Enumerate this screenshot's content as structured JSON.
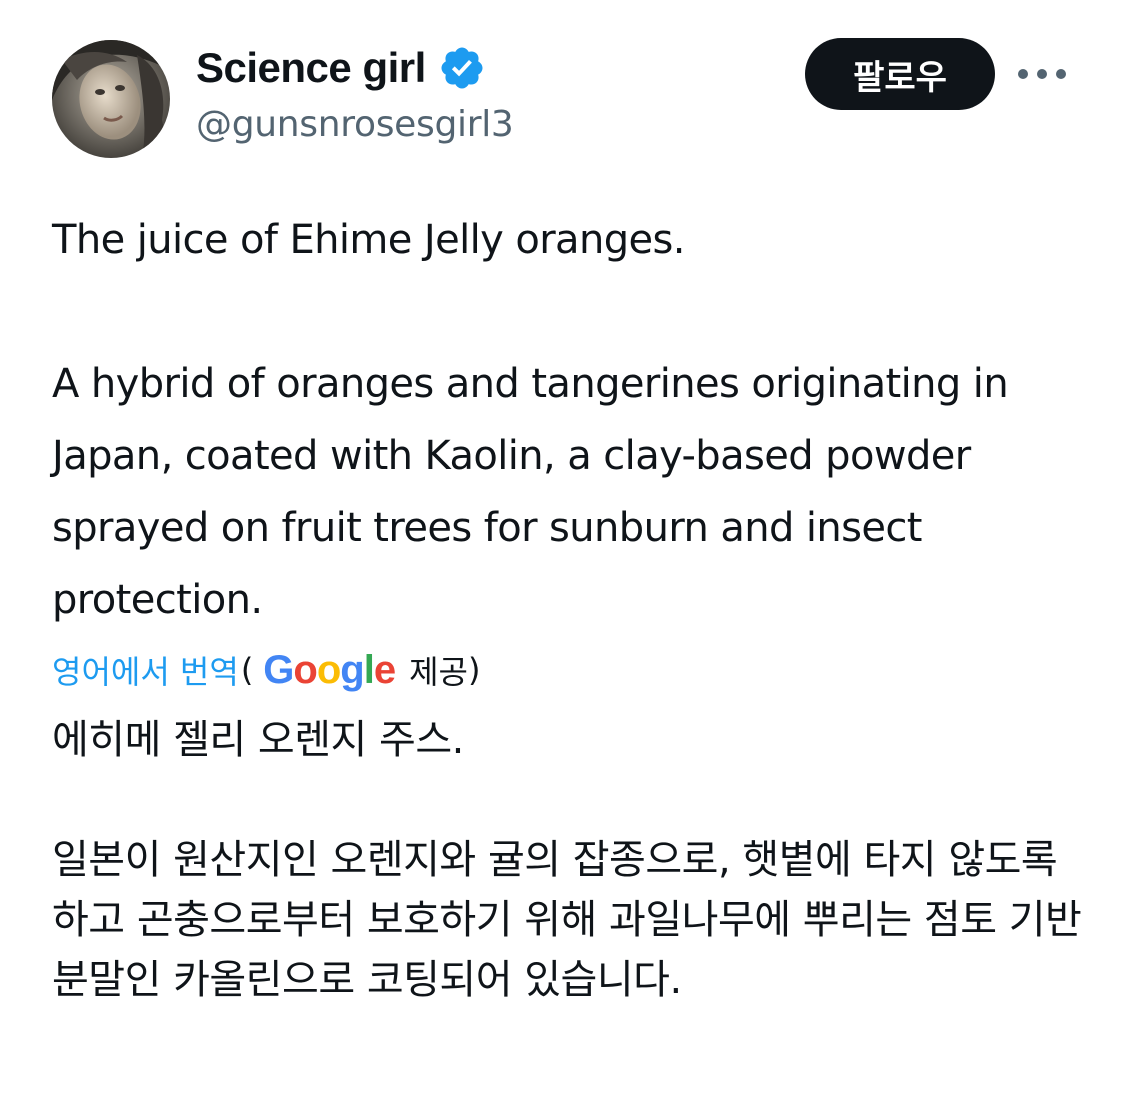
{
  "tweet": {
    "author": {
      "display_name": "Science girl",
      "handle": "@gunsnrosesgirl3",
      "verified": true,
      "avatar_icon": "profile-photo"
    },
    "follow_button_label": "팔로우",
    "more_icon": "more-dots-icon",
    "text": "The juice of Ehime Jelly oranges.\n\nA hybrid of oranges and tangerines originating in Japan, coated with Kaolin, a clay-based powder sprayed on fruit trees for sunburn and insect protection.",
    "translation": {
      "link_label": "영어에서 번역",
      "open_paren": "(",
      "provider_logo_text": "Google",
      "provided_label": "제공",
      "close_paren": ")",
      "text": "에히메 젤리 오렌지 주스.\n\n일본이 원산지인 오렌지와 귤의 잡종으로, 햇볕에 타지 않도록 하고 곤충으로부터 보호하기 위해 과일나무에 뿌리는 점토 기반 분말인 카올린으로 코팅되어 있습니다."
    }
  },
  "colors": {
    "text_primary": "#0f1419",
    "text_secondary": "#536471",
    "link_blue": "#1d9bf0",
    "verified_blue": "#1d9bf0",
    "follow_bg": "#0f1419",
    "google_blue": "#4285f4",
    "google_red": "#ea4335",
    "google_yellow": "#fbbc05",
    "google_green": "#34a853"
  }
}
